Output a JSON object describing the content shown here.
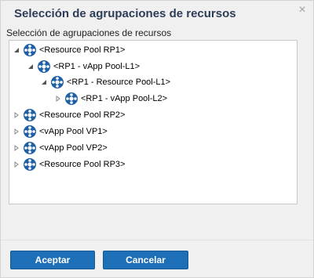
{
  "dialog": {
    "title": "Selección de agrupaciones de recursos",
    "close_glyph": "×",
    "section_label": "Selección de agrupaciones de recursos"
  },
  "tree": {
    "items": [
      {
        "label": "<Resource Pool RP1>",
        "level": 0,
        "expanded": true,
        "icon": "resource-pool-icon"
      },
      {
        "label": "<RP1 - vApp Pool-L1>",
        "level": 1,
        "expanded": true,
        "icon": "resource-pool-icon"
      },
      {
        "label": "<RP1 - Resource Pool-L1>",
        "level": 2,
        "expanded": true,
        "icon": "resource-pool-icon"
      },
      {
        "label": "<RP1 - vApp Pool-L2>",
        "level": 3,
        "expanded": false,
        "icon": "resource-pool-icon"
      },
      {
        "label": "<Resource Pool RP2>",
        "level": 0,
        "expanded": false,
        "icon": "resource-pool-icon"
      },
      {
        "label": "<vApp Pool VP1>",
        "level": 0,
        "expanded": false,
        "icon": "resource-pool-icon"
      },
      {
        "label": "<vApp Pool VP2>",
        "level": 0,
        "expanded": false,
        "icon": "resource-pool-icon"
      },
      {
        "label": "<Resource Pool RP3>",
        "level": 0,
        "expanded": false,
        "icon": "resource-pool-icon"
      }
    ]
  },
  "buttons": {
    "accept_label": "Aceptar",
    "cancel_label": "Cancelar"
  },
  "colors": {
    "title": "#2e3d57",
    "button": "#1d6fb8",
    "icon": "#1f5fa3"
  }
}
